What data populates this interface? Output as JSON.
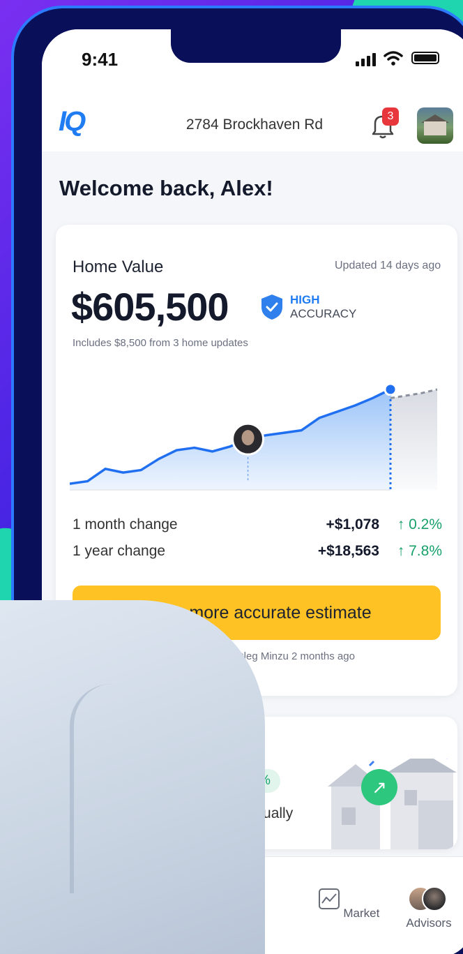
{
  "status": {
    "time": "9:41"
  },
  "header": {
    "logo": "IQ",
    "address": "2784 Brockhaven Rd",
    "notification_count": "3"
  },
  "welcome": "Welcome back, Alex!",
  "home_value_card": {
    "title": "Home Value",
    "updated": "Updated 14 days ago",
    "value": "$605,500",
    "accuracy_line1": "HIGH",
    "accuracy_line2": "ACCURACY",
    "includes": "Includes $8,500 from 3 home updates",
    "changes": [
      {
        "label": "1 month change",
        "amount": "+$1,078",
        "percent": "↑ 0.2%"
      },
      {
        "label": "1 year change",
        "amount": "+$18,563",
        "percent": "↑ 7.8%"
      }
    ],
    "cta_label": "Get a more accurate estimate",
    "last_updated": "Last updated by Oleg Minzu 2 months ago"
  },
  "appreciation_card": {
    "percent": "27.8%",
    "period_text": "annually"
  },
  "tabs": [
    {
      "label": "Market",
      "icon": "chart-icon"
    },
    {
      "label": "Advisors",
      "icon": "advisors-avatars"
    }
  ],
  "colors": {
    "accent": "#1f7cf2",
    "cta": "#fec224",
    "positive": "#17a06a",
    "badge": "#e8363d"
  },
  "chart_data": {
    "type": "area",
    "x": [
      0,
      1,
      2,
      3,
      4,
      5,
      6,
      7,
      8,
      9,
      10,
      11,
      12,
      13,
      14,
      15,
      16,
      17,
      18
    ],
    "y": [
      10,
      14,
      34,
      28,
      32,
      50,
      64,
      68,
      62,
      70,
      82,
      88,
      92,
      96,
      116,
      126,
      136,
      148,
      162
    ],
    "projection": [
      148,
      152,
      156,
      162
    ],
    "marker_index": 10,
    "current_index": 18,
    "title": "",
    "xlabel": "",
    "ylabel": ""
  }
}
